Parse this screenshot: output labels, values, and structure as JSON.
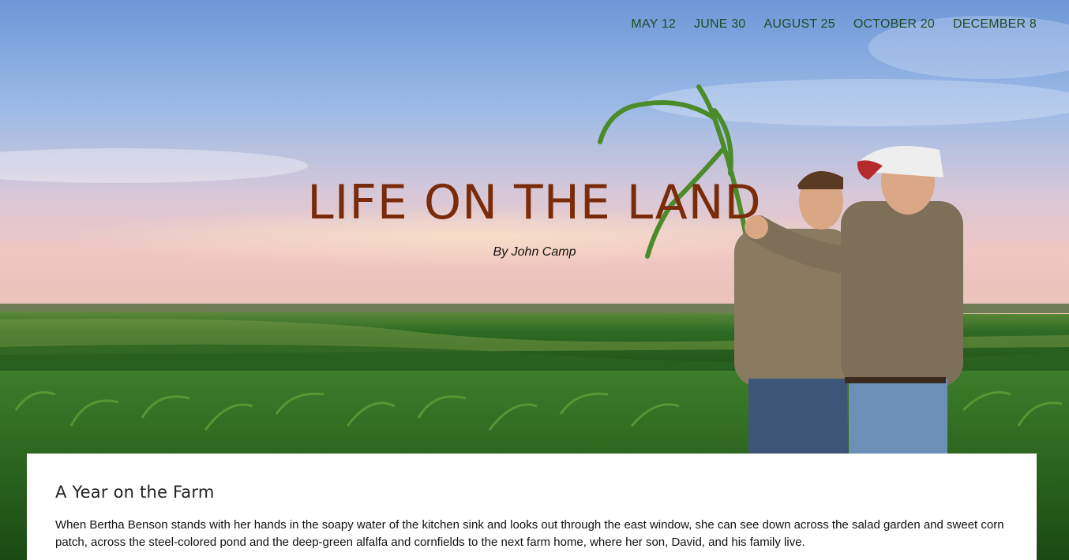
{
  "nav": {
    "items": [
      {
        "label": "MAY 12"
      },
      {
        "label": "JUNE 30"
      },
      {
        "label": "AUGUST 25"
      },
      {
        "label": "OCTOBER 20"
      },
      {
        "label": "DECEMBER 8"
      }
    ]
  },
  "hero": {
    "title": "LIFE ON THE LAND",
    "byline": "By John Camp",
    "image_subject": "two farmers holding a corn plant in a field at sunset"
  },
  "article": {
    "title": "A Year on the Farm",
    "body": "When Bertha Benson stands with her hands in the soapy water of the kitchen sink and looks out through the east window, she can see down across the salad garden and sweet corn patch, across the steel-colored pond and the deep-green alfalfa and cornfields to the next farm home, where her son, David, and his family live."
  },
  "colors": {
    "title": "#7a2c0a",
    "nav": "#1f4a25",
    "sky": "#6f99d6",
    "field": "#2f6b24"
  }
}
